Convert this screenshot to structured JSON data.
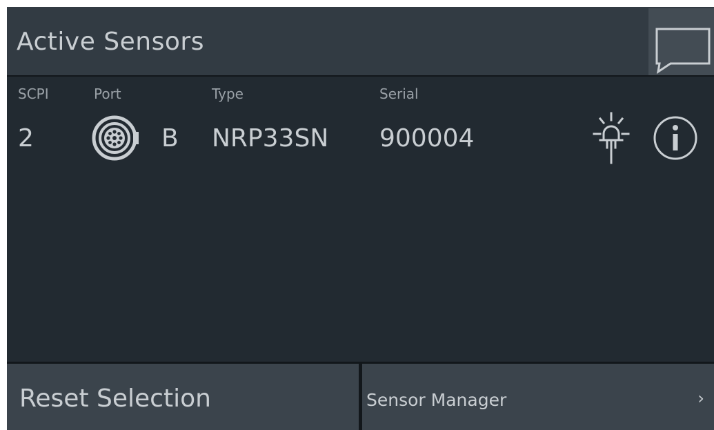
{
  "header": {
    "title": "Active Sensors",
    "message_icon": "speech-bubble-icon"
  },
  "table": {
    "columns": [
      "SCPI",
      "Port",
      "Type",
      "Serial"
    ],
    "rows": [
      {
        "scpi": "2",
        "port_icon": "connector-icon",
        "port": "B",
        "type": "NRP33SN",
        "serial": "900004",
        "identify_icon": "lamp-icon",
        "info_icon": "info-icon"
      }
    ]
  },
  "footer": {
    "reset_label": "Reset Selection",
    "manager_label": "Sensor Manager",
    "manager_chevron": "›"
  },
  "colors": {
    "background": "#222a31",
    "header": "#323b43",
    "button": "#3b444c",
    "text": "#c9ced2",
    "muted_text": "#9aa1a7"
  }
}
